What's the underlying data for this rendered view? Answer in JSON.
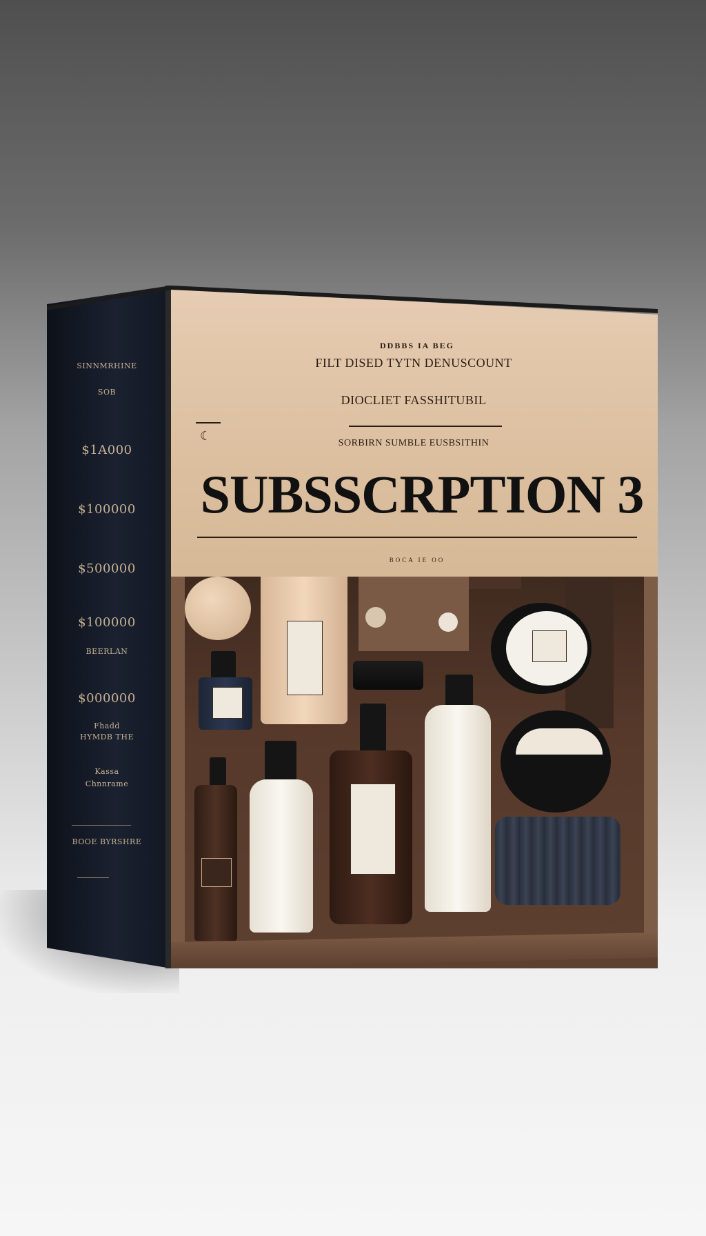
{
  "box": {
    "front": {
      "tagline_top": "DDBBS IA BEG",
      "line1": "FILT DISED TYTN DENUSCOUNT",
      "line2": "DIOCLIET FASSHITUBIL",
      "line3": "SORBIRN SUMBLE EUSBSITHIN",
      "title": "SUBSSCRPTION 3",
      "bottom_text": "BOCA IE OO"
    },
    "spine": {
      "heading": "SINNMRHINE",
      "sub": "SOB",
      "prices": [
        "$1A000",
        "$100000",
        "$500000",
        "$100000",
        "$000000"
      ],
      "small_label_1": "BEERLAN",
      "small_label_2a": "Fhadd",
      "small_label_2b": "HYMDB THE",
      "small_label_3a": "Kassa",
      "small_label_3b": "Chnnrame",
      "footer": "BOOE BYRSHRE"
    }
  },
  "colors": {
    "panel": "#dcbf9f",
    "spine": "#161c29",
    "interior": "#56392b",
    "title_text": "#111111"
  }
}
